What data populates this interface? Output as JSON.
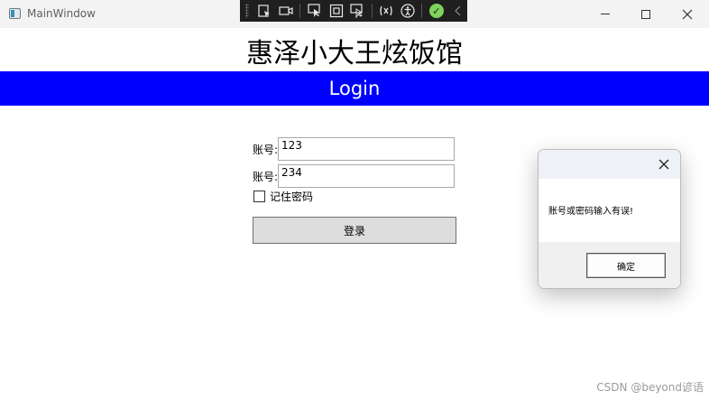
{
  "window": {
    "title": "MainWindow"
  },
  "header": {
    "restaurant_name": "惠泽小大王炫饭馆",
    "banner_text": "Login",
    "banner_color": "#0000ff"
  },
  "form": {
    "account_label": "账号:",
    "account_value": "123",
    "password_label": "账号:",
    "password_value": "234",
    "remember_label": "记住密码",
    "remember_checked": false,
    "login_button": "登录"
  },
  "message_box": {
    "message": "账号或密码输入有误!",
    "ok_button": "确定"
  },
  "watermark": "CSDN @beyond谚语",
  "icons": {
    "debug_toolbar": [
      "select-element-icon",
      "preview-icon",
      "pointer-select-icon",
      "layout-adorner-icon",
      "track-focus-icon",
      "hot-reload-icon",
      "accessibility-icon",
      "binding-ok-icon",
      "collapse-icon"
    ],
    "window_controls": [
      "minimize-icon",
      "maximize-icon",
      "close-icon"
    ]
  }
}
